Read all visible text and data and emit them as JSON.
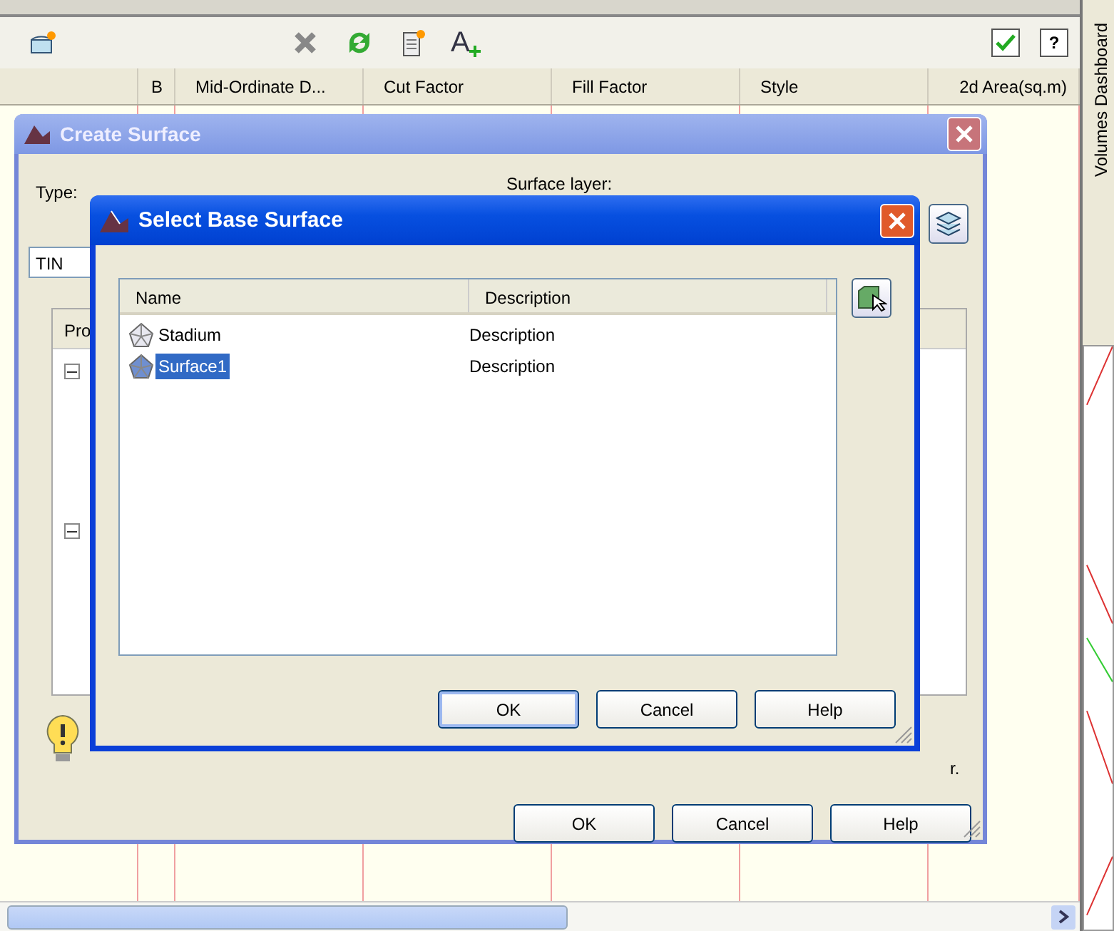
{
  "toolbar": {
    "add_text_glyph": "A",
    "help_glyph": "?",
    "checked": true
  },
  "columns": [
    "",
    "B",
    "Mid-Ordinate D...",
    "Cut Factor",
    "Fill Factor",
    "Style",
    "2d Area(sq.m)"
  ],
  "side_tab": "Volumes Dashboard",
  "create_surface": {
    "title": "Create Surface",
    "type_label": "Type:",
    "type_value": "TIN",
    "layer_label": "Surface layer:",
    "grid_header": "Pro",
    "note_fragment": "r.",
    "buttons": [
      {
        "label": "OK",
        "default": false
      },
      {
        "label": "Cancel",
        "default": false
      },
      {
        "label": "Help",
        "default": false
      }
    ]
  },
  "select_base_surface": {
    "title": "Select Base Surface",
    "columns": [
      "Name",
      "Description"
    ],
    "rows": [
      {
        "name": "Stadium",
        "description": "Description",
        "selected": false
      },
      {
        "name": "Surface1",
        "description": "Description",
        "selected": true
      }
    ],
    "buttons": [
      {
        "label": "OK",
        "default": true
      },
      {
        "label": "Cancel",
        "default": false
      },
      {
        "label": "Help",
        "default": false
      }
    ]
  }
}
